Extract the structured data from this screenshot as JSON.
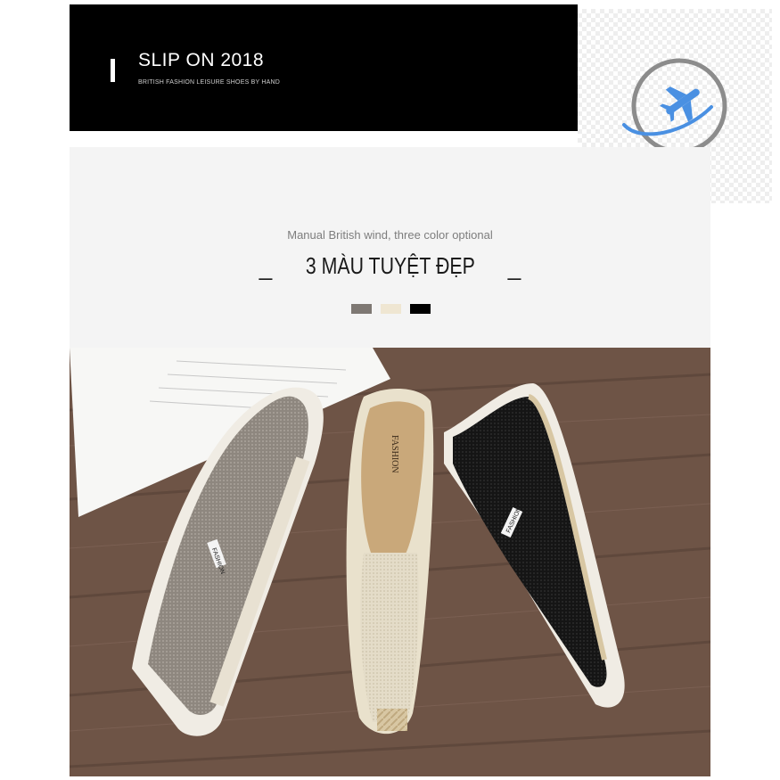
{
  "banner": {
    "title": "SLIP ON 2018",
    "subtitle": "BRITISH FASHION LEISURE SHOES BY HAND"
  },
  "logo": {
    "icon": "airplane-globe-logo",
    "ring_color": "#8c8c8c",
    "accent_color": "#4a90e2"
  },
  "intro": {
    "tagline": "Manual British wind, three color optional",
    "heading_left_dash": "_",
    "heading": "3 MÀU TUYỆT ĐẸP",
    "heading_right_dash": "_"
  },
  "colors": [
    {
      "name": "grey",
      "hex": "#7e7873"
    },
    {
      "name": "beige",
      "hex": "#efe6d2"
    },
    {
      "name": "black",
      "hex": "#000000"
    }
  ],
  "photo": {
    "shoe_grey": {
      "label": "FASHION",
      "color": "#8e877f"
    },
    "shoe_beige": {
      "insole_label": "FASHION",
      "color": "#e4dcc8"
    },
    "shoe_black": {
      "label": "FASHION",
      "color": "#151515"
    }
  }
}
